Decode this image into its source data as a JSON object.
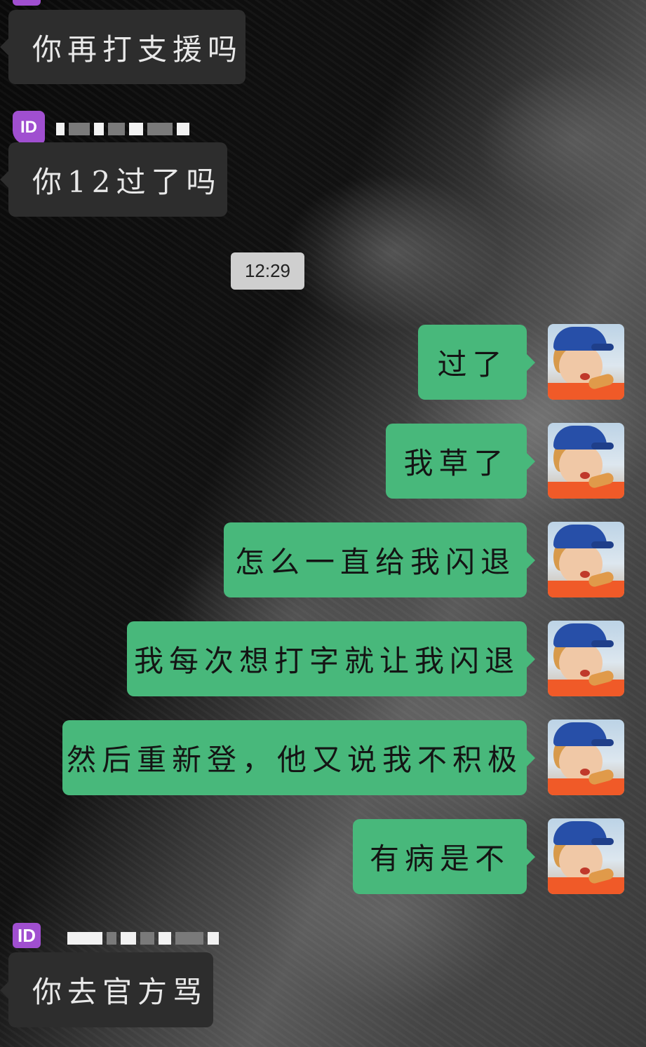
{
  "timestamp": "12:29",
  "messages": {
    "m1": "你再打支援吗",
    "m2": "你12过了吗",
    "m3": "过了",
    "m4": "我草了",
    "m5": "怎么一直给我闪退",
    "m6": "我每次想打字就让我闪退",
    "m7": "然后重新登，他又说我不积极",
    "m8": "有病是不",
    "m9": "你去官方骂"
  },
  "sender_badge": "ID",
  "colors": {
    "incoming_bubble": "#2d2d2d",
    "outgoing_bubble": "#48b87b",
    "badge": "#a04fd0",
    "timestamp_bg": "#cfcfcf"
  }
}
